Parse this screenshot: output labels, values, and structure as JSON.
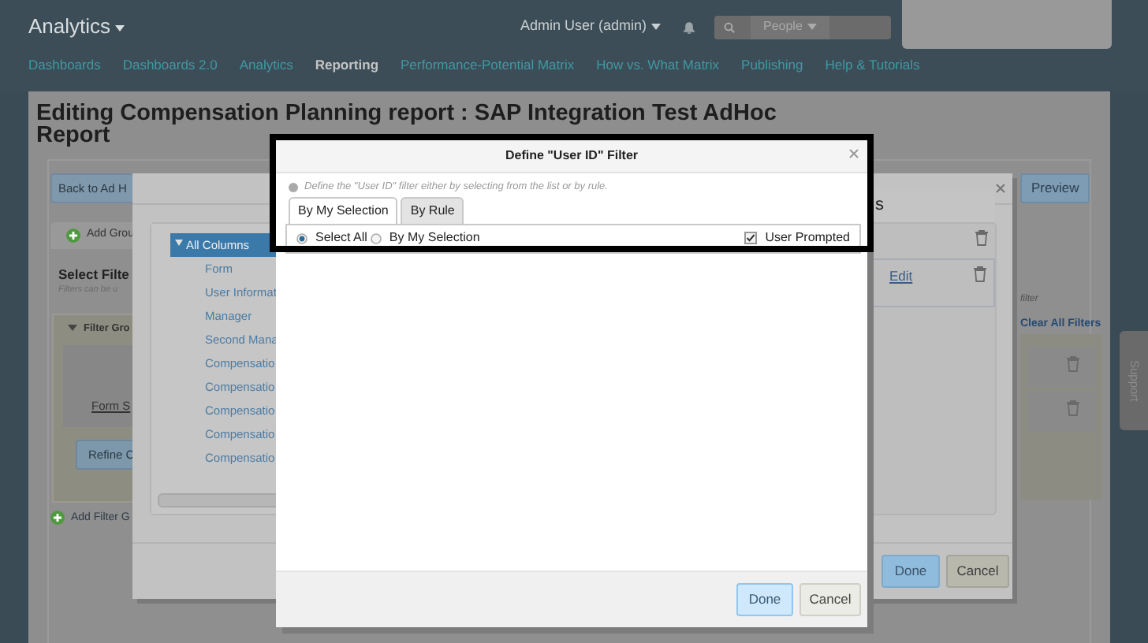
{
  "navbar": {
    "brand": "Analytics",
    "user": "Admin User (admin)",
    "search_scope": "People",
    "links": [
      {
        "label": "Dashboards",
        "selected": false
      },
      {
        "label": "Dashboards 2.0",
        "selected": false
      },
      {
        "label": "Analytics",
        "selected": false
      },
      {
        "label": "Reporting",
        "selected": true
      },
      {
        "label": "Performance-Potential Matrix",
        "selected": false
      },
      {
        "label": "How vs. What Matrix",
        "selected": false
      },
      {
        "label": "Publishing",
        "selected": false
      },
      {
        "label": "Help & Tutorials",
        "selected": false
      }
    ]
  },
  "page": {
    "title": "Editing Compensation Planning report : SAP Integration Test AdHoc Report",
    "back_button": "Back to Ad H",
    "preview_button": "Preview",
    "add_group_tab": "Add Grou",
    "section_title": "Select Filte",
    "section_hint": "Filters can be u",
    "filter_group": "Filter Gro",
    "form_link": "Form S",
    "refine_button": "Refine C",
    "add_filter_group": "Add Filter G",
    "filter_hint": "filter",
    "clear_all": "Clear All Filters"
  },
  "support_tab": "Support",
  "column_dialog": {
    "columns": [
      {
        "label": "All Columns",
        "selected": true
      },
      {
        "label": "Form",
        "selected": false
      },
      {
        "label": "User Informat",
        "selected": false
      },
      {
        "label": "Manager",
        "selected": false
      },
      {
        "label": "Second Mana",
        "selected": false
      },
      {
        "label": "Compensatio",
        "selected": false
      },
      {
        "label": "Compensatio",
        "selected": false
      },
      {
        "label": "Compensatio",
        "selected": false
      },
      {
        "label": "Compensatio",
        "selected": false
      },
      {
        "label": "Compensatio",
        "selected": false
      }
    ],
    "panel_heading": "s",
    "edit_link": "Edit",
    "buttons": [
      "Done",
      "Cancel"
    ]
  },
  "filter_dialog": {
    "title": "Define \"User ID\" Filter",
    "help": "Define the \"User ID\" filter either by selecting from the list or by rule.",
    "tabs": [
      {
        "label": "By My Selection",
        "selected": true
      },
      {
        "label": "By Rule",
        "selected": false
      }
    ],
    "options": [
      {
        "label": "Select All",
        "selected": true
      },
      {
        "label": "By My Selection",
        "selected": false
      }
    ],
    "user_prompted": {
      "label": "User Prompted",
      "checked": true
    },
    "buttons": [
      "Done",
      "Cancel"
    ]
  }
}
